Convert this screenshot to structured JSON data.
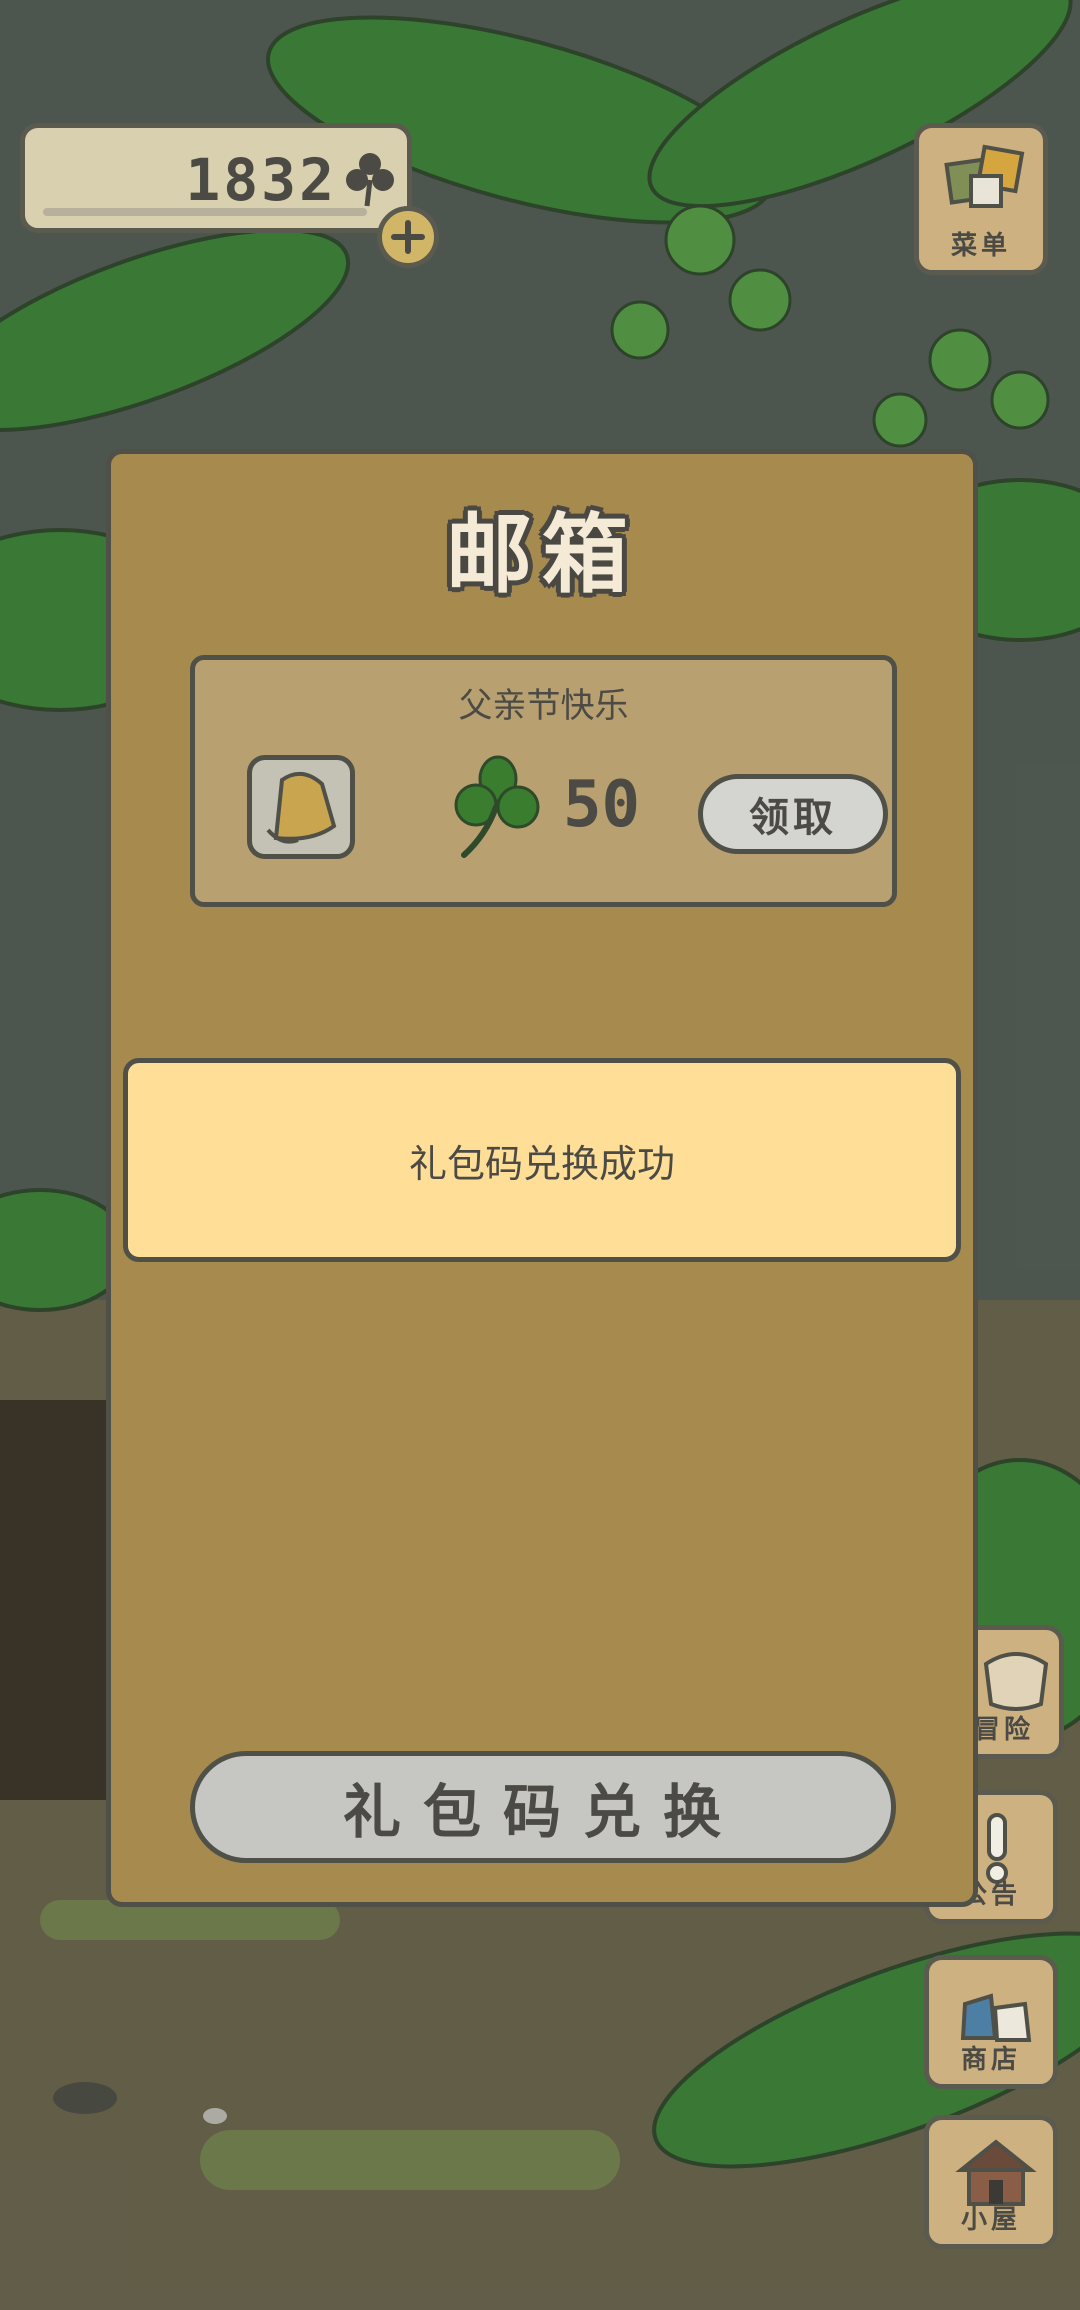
{
  "hud": {
    "clover_count": "1832",
    "add_icon": "plus-icon",
    "clover_icon": "clover-icon"
  },
  "side_menu": {
    "menu_label": "菜单",
    "adventure_label": "冒险",
    "notice_label": "公告",
    "shop_label": "商店",
    "house_label": "小屋"
  },
  "mailbox": {
    "title": "邮箱",
    "items": [
      {
        "subject": "父亲节快乐",
        "gift_icon": "bell-icon",
        "reward_icon": "clover-icon",
        "reward_amount": "50",
        "claim_label": "领取"
      }
    ],
    "toast": "礼包码兑换成功",
    "redeem_label": "礼包码兑换"
  },
  "colors": {
    "panel": "#a68a4e",
    "toast": "#ffdf98",
    "clover": "#3a7d2f",
    "outline": "#4f5047"
  }
}
